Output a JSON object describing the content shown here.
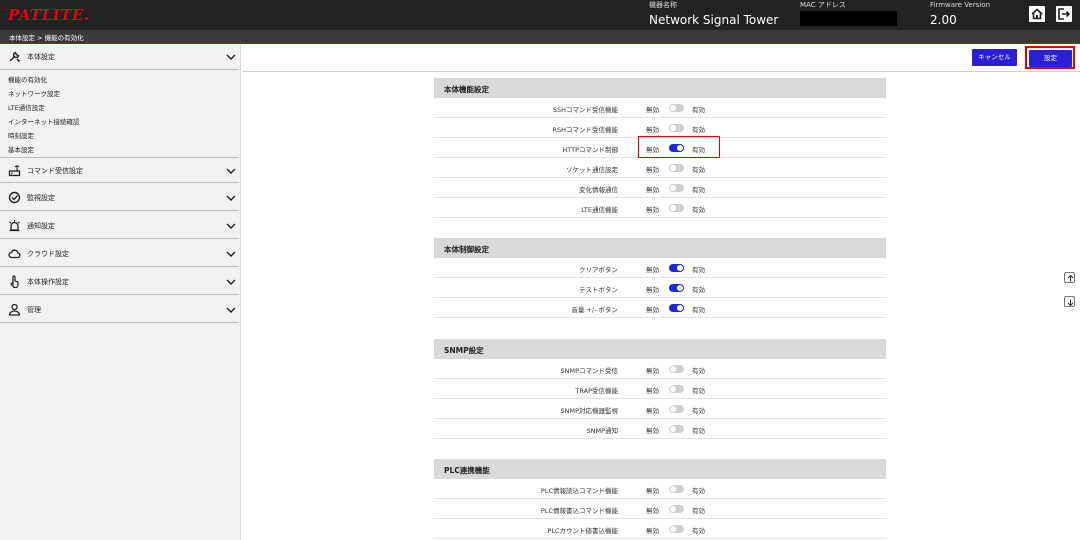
{
  "header": {
    "logo": "PATLITE.",
    "device_name_label": "機器名称",
    "device_name": "Network Signal Tower",
    "mac_label": "MAC アドレス",
    "firmware_label": "Firmware Version",
    "firmware_value": "2.00"
  },
  "breadcrumb": "本体設定 > 機能の有効化",
  "sidebar": {
    "main": {
      "label": "本体設定",
      "icon": "wrench-icon"
    },
    "subitems": [
      "機能の有効化",
      "ネットワーク設定",
      "LTE通信設定",
      "インターネット接続確認",
      "時刻設定",
      "基本設定"
    ],
    "groups": [
      {
        "label": "コマンド受信設定",
        "icon": "router-icon"
      },
      {
        "label": "監視設定",
        "icon": "monitor-check-icon"
      },
      {
        "label": "通知設定",
        "icon": "alarm-icon"
      },
      {
        "label": "クラウド設定",
        "icon": "cloud-icon"
      },
      {
        "label": "本体操作設定",
        "icon": "hand-pointer-icon"
      },
      {
        "label": "管理",
        "icon": "user-icon"
      }
    ]
  },
  "toolbar": {
    "cancel_label": "キャンセル",
    "save_label": "設定"
  },
  "toggle_off_label": "無効",
  "toggle_on_label": "有効",
  "sections": [
    {
      "title": "本体機能設定",
      "rows": [
        {
          "label": "SSHコマンド受信機能",
          "enabled": false
        },
        {
          "label": "RSHコマンド受信機能",
          "enabled": false
        },
        {
          "label": "HTTPコマンド制御",
          "enabled": true
        },
        {
          "label": "ソケット通信設定",
          "enabled": false
        },
        {
          "label": "変化情報通信",
          "enabled": false
        },
        {
          "label": "LTE通信機能",
          "enabled": false
        }
      ]
    },
    {
      "title": "本体制御設定",
      "rows": [
        {
          "label": "クリアボタン",
          "enabled": true
        },
        {
          "label": "テストボタン",
          "enabled": true
        },
        {
          "label": "音量 +/- ボタン",
          "enabled": true
        }
      ]
    },
    {
      "title": "SNMP設定",
      "rows": [
        {
          "label": "SNMPコマンド受信",
          "enabled": false
        },
        {
          "label": "TRAP受信機能",
          "enabled": false
        },
        {
          "label": "SNMP対応機器監視",
          "enabled": false
        },
        {
          "label": "SNMP通知",
          "enabled": false
        }
      ]
    },
    {
      "title": "PLC連携機能",
      "rows": [
        {
          "label": "PLC情報読込コマンド機能",
          "enabled": false
        },
        {
          "label": "PLC情報書込コマンド機能",
          "enabled": false
        },
        {
          "label": "PLCカウント値書込機能",
          "enabled": false
        }
      ]
    }
  ],
  "colors": {
    "accent": "#2b1fd6",
    "toggle_on": "#1b2bd6",
    "highlight": "#e00000",
    "header_bg": "#222222"
  }
}
